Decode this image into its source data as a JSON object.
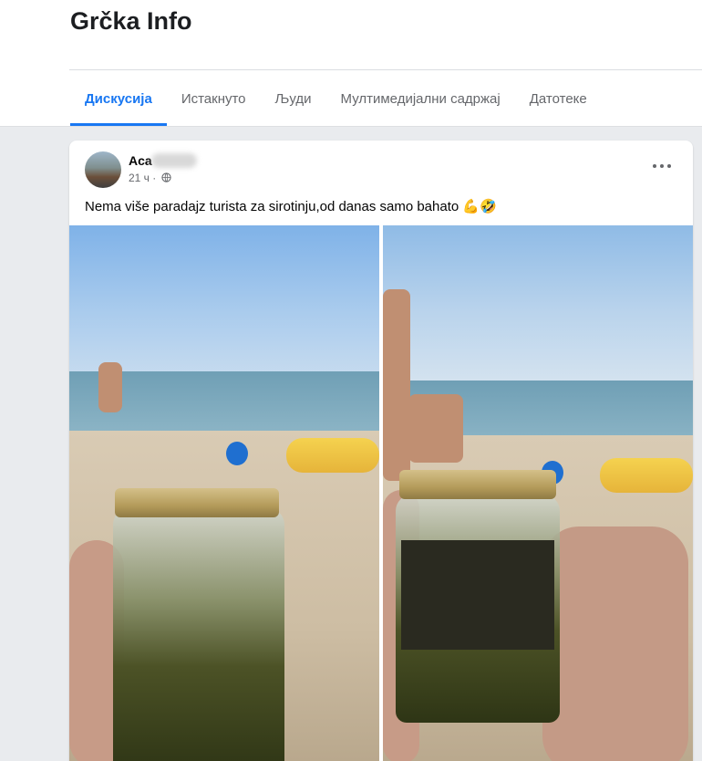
{
  "group": {
    "title": "Grčka Info"
  },
  "tabs": [
    {
      "label": "Дискусија",
      "active": true
    },
    {
      "label": "Истакнуто"
    },
    {
      "label": "Људи"
    },
    {
      "label": "Мултимедијални садржај"
    },
    {
      "label": "Датотеке"
    }
  ],
  "post": {
    "author": "Aca",
    "time": "21 ч ·",
    "caption": "Nema više paradajz turista za sirotinju,od danas samo bahato 💪🤣",
    "icons": {
      "menu": "more-options-icon",
      "audience": "globe-icon"
    }
  },
  "colors": {
    "accent": "#1877f2",
    "text": "#050505",
    "muted": "#65676b",
    "background": "#e9ebee"
  }
}
